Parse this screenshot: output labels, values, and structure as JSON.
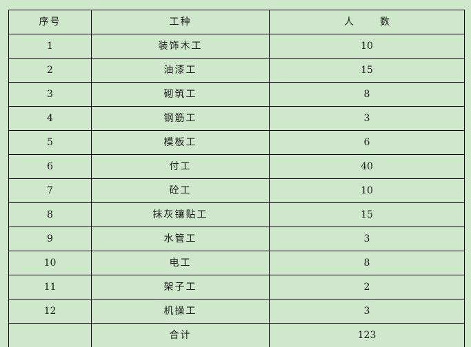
{
  "table": {
    "headers": {
      "index": "序号",
      "trade": "工种",
      "count_char1": "人",
      "count_char2": "数"
    },
    "rows": [
      {
        "index": "1",
        "trade": "装饰木工",
        "count": "10"
      },
      {
        "index": "2",
        "trade": "油漆工",
        "count": "15"
      },
      {
        "index": "3",
        "trade": "砌筑工",
        "count": "8"
      },
      {
        "index": "4",
        "trade": "钢筋工",
        "count": "3"
      },
      {
        "index": "5",
        "trade": "模板工",
        "count": "6"
      },
      {
        "index": "6",
        "trade": "付工",
        "count": "40"
      },
      {
        "index": "7",
        "trade": "砼工",
        "count": "10"
      },
      {
        "index": "8",
        "trade": "抹灰镶贴工",
        "count": "15"
      },
      {
        "index": "9",
        "trade": "水管工",
        "count": "3"
      },
      {
        "index": "10",
        "trade": "电工",
        "count": "8"
      },
      {
        "index": "11",
        "trade": "架子工",
        "count": "2"
      },
      {
        "index": "12",
        "trade": "机操工",
        "count": "3"
      }
    ],
    "total": {
      "index": "",
      "label": "合计",
      "count": "123"
    }
  },
  "colors": {
    "background": "#cfe8cb",
    "border": "#000000"
  }
}
